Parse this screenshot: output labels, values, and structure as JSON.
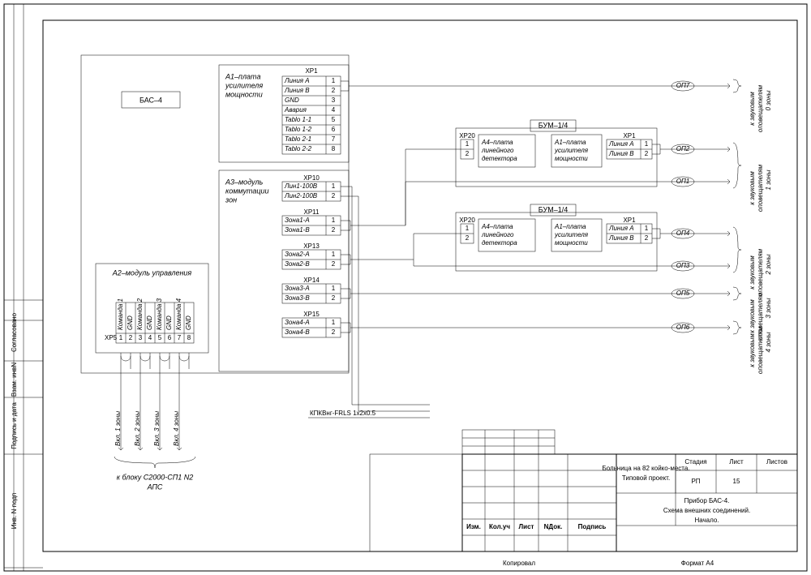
{
  "device": {
    "title": "БАС–4"
  },
  "a1": {
    "title1": "А1–плата",
    "title2": "усилителя",
    "title3": "мощности",
    "header": "XP1",
    "rows": [
      {
        "l": "Линия A",
        "n": "1"
      },
      {
        "l": "Линия B",
        "n": "2"
      },
      {
        "l": "GND",
        "n": "3"
      },
      {
        "l": "Авария",
        "n": "4"
      },
      {
        "l": "Tablo 1-1",
        "n": "5"
      },
      {
        "l": "Tablo 1-2",
        "n": "6"
      },
      {
        "l": "Tablo 2-1",
        "n": "7"
      },
      {
        "l": "Tablo 2-2",
        "n": "8"
      }
    ]
  },
  "a3": {
    "title1": "А3–модуль",
    "title2": "коммутации",
    "title3": "зон",
    "groups": [
      {
        "header": "XP10",
        "rows": [
          {
            "l": "Лин1-100В",
            "n": "1"
          },
          {
            "l": "Лин2-100В",
            "n": "2"
          }
        ]
      },
      {
        "header": "XP11",
        "rows": [
          {
            "l": "Зона1-А",
            "n": "1"
          },
          {
            "l": "Зона1-В",
            "n": "2"
          }
        ]
      },
      {
        "header": "XP13",
        "rows": [
          {
            "l": "Зона2-А",
            "n": "1"
          },
          {
            "l": "Зона2-В",
            "n": "2"
          }
        ]
      },
      {
        "header": "XP14",
        "rows": [
          {
            "l": "Зона3-А",
            "n": "1"
          },
          {
            "l": "Зона3-В",
            "n": "2"
          }
        ]
      },
      {
        "header": "XP15",
        "rows": [
          {
            "l": "Зона4-А",
            "n": "1"
          },
          {
            "l": "Зона4-В",
            "n": "2"
          }
        ]
      }
    ]
  },
  "a2": {
    "title": "А2–модуль управления",
    "header": "XP5",
    "rows": [
      {
        "n": "1",
        "l": "Команда 1"
      },
      {
        "n": "2",
        "l": "GND"
      },
      {
        "n": "3",
        "l": "Команда 2"
      },
      {
        "n": "4",
        "l": "GND"
      },
      {
        "n": "5",
        "l": "Команда 3"
      },
      {
        "n": "6",
        "l": "GND"
      },
      {
        "n": "7",
        "l": "Команда 4"
      },
      {
        "n": "8",
        "l": "GND"
      }
    ],
    "exits": [
      "Вкл. 1 зоны",
      "Вкл. 2 зоны",
      "Вкл. 3 зоны",
      "Вкл. 4 зоны"
    ],
    "dest1": "к блоку С2000-СП1 N2",
    "dest2": "АПС"
  },
  "bum": {
    "title": "БУМ–1/4",
    "xp20": "XP20",
    "xp20_rows": [
      "1",
      "2"
    ],
    "a4_1": "А4–плата",
    "a4_2": "линейного",
    "a4_3": "детектора",
    "a1_1": "А1–плата",
    "a1_2": "усилителя",
    "a1_3": "мощности",
    "xp1": "XP1",
    "xp1_rows": [
      {
        "l": "Линия А",
        "n": "1"
      },
      {
        "l": "Линия В",
        "n": "2"
      }
    ]
  },
  "outputs": {
    "op7": "ОП7",
    "op2": "ОП2",
    "op1": "ОП1",
    "op4": "ОП4",
    "op3": "ОП3",
    "op5": "ОП5",
    "op6": "ОП6",
    "dest_top": "к звуковым",
    "dest_bot": "оповещателям",
    "zones": [
      "0 зоны",
      "1 зоны",
      "2 зоны",
      "3 зоны",
      "4 зоны"
    ]
  },
  "cable": "КПКВнг-FRLS 1x2x0.5",
  "titleblock": {
    "changes": [
      "Изм.",
      "Кол.уч",
      "Лист",
      "NДок.",
      "Подпись"
    ],
    "project1": "Больница на 82 койко-места.",
    "project2": "Типовой проект.",
    "drawing1": "Прибор БАС-4.",
    "drawing2": "Схема внешних соединений.",
    "drawing3": "Начало.",
    "stage_h": "Стадия",
    "stage_v": "РП",
    "sheet_h": "Лист",
    "sheet_v": "15",
    "sheets_h": "Листов",
    "sheets_v": ""
  },
  "footer": {
    "copy": "Копировал",
    "format": "Формат  А4"
  },
  "sidebar": [
    "Инв. N подп",
    "Подпись и дата",
    "Взам. инвN",
    "Согласовано"
  ]
}
